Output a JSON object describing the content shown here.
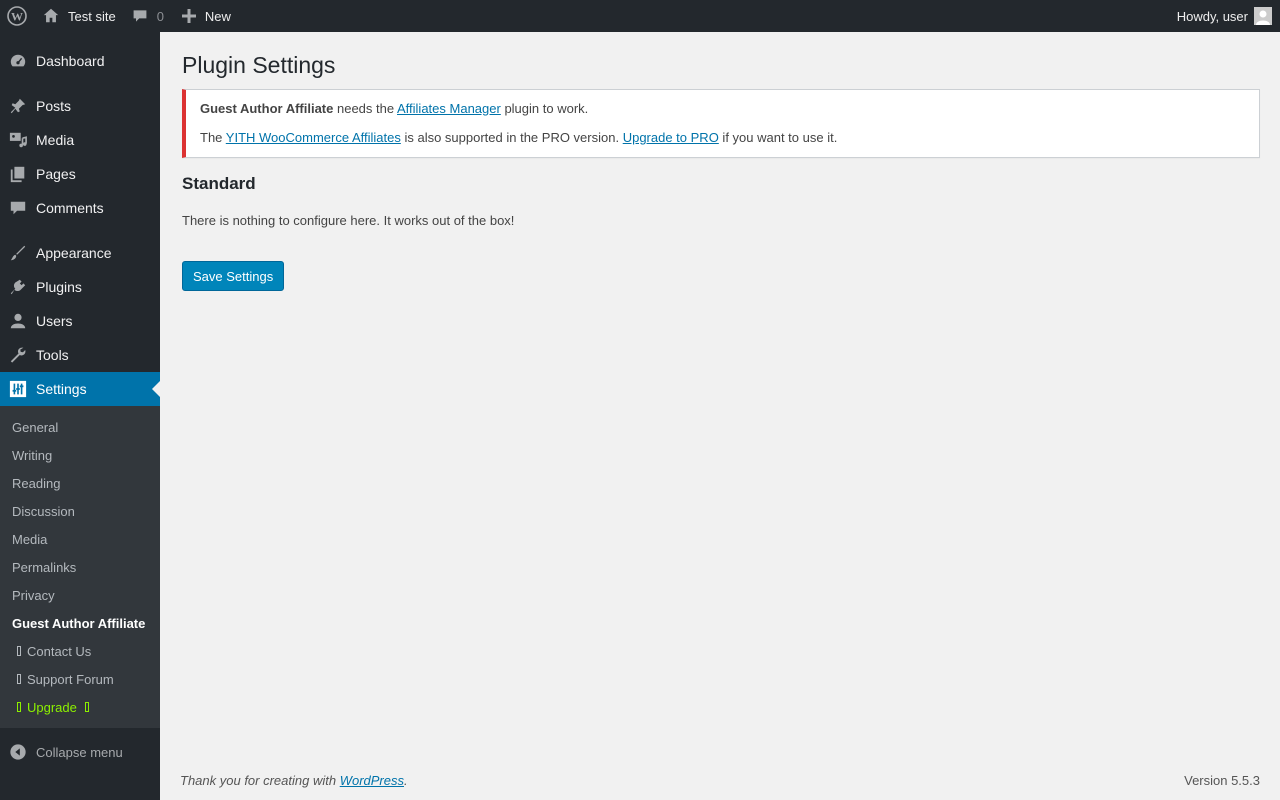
{
  "adminbar": {
    "site_name": "Test site",
    "comments_count": "0",
    "new_label": "New",
    "greeting": "Howdy, user"
  },
  "sidebar": {
    "items": [
      {
        "label": "Dashboard",
        "icon": "dashboard-icon"
      },
      {
        "label": "Posts",
        "icon": "pin-icon"
      },
      {
        "label": "Media",
        "icon": "media-icon"
      },
      {
        "label": "Pages",
        "icon": "pages-icon"
      },
      {
        "label": "Comments",
        "icon": "comment-icon"
      },
      {
        "label": "Appearance",
        "icon": "brush-icon"
      },
      {
        "label": "Plugins",
        "icon": "plug-icon"
      },
      {
        "label": "Users",
        "icon": "user-icon"
      },
      {
        "label": "Tools",
        "icon": "wrench-icon"
      },
      {
        "label": "Settings",
        "icon": "settings-icon"
      }
    ],
    "submenu": {
      "general": "General",
      "writing": "Writing",
      "reading": "Reading",
      "discussion": "Discussion",
      "media": "Media",
      "permalinks": "Permalinks",
      "privacy": "Privacy",
      "guest_author_affiliate": "Guest Author Affiliate",
      "contact_us": "Contact Us",
      "support_forum": "Support Forum",
      "upgrade": "Upgrade"
    },
    "collapse_label": "Collapse menu"
  },
  "main": {
    "title": "Plugin Settings",
    "notice": {
      "line1_bold": "Guest Author Affiliate",
      "line1_mid": " needs the ",
      "line1_link": "Affiliates Manager",
      "line1_end": " plugin to work.",
      "line2_start": "The ",
      "line2_link1": "YITH WooCommerce Affiliates",
      "line2_mid": " is also supported in the PRO version. ",
      "line2_link2": "Upgrade to PRO",
      "line2_end": " if you want to use it."
    },
    "section_title": "Standard",
    "section_text": "There is nothing to configure here. It works out of the box!",
    "save_label": "Save Settings"
  },
  "footer": {
    "thanks_prefix": "Thank you for creating with ",
    "thanks_link": "WordPress",
    "thanks_suffix": ".",
    "version": "Version 5.5.3"
  },
  "colors": {
    "sidebar_bg": "#23282d",
    "accent": "#0073aa",
    "notice_error": "#dc3232",
    "upgrade_green": "#8cf000"
  }
}
